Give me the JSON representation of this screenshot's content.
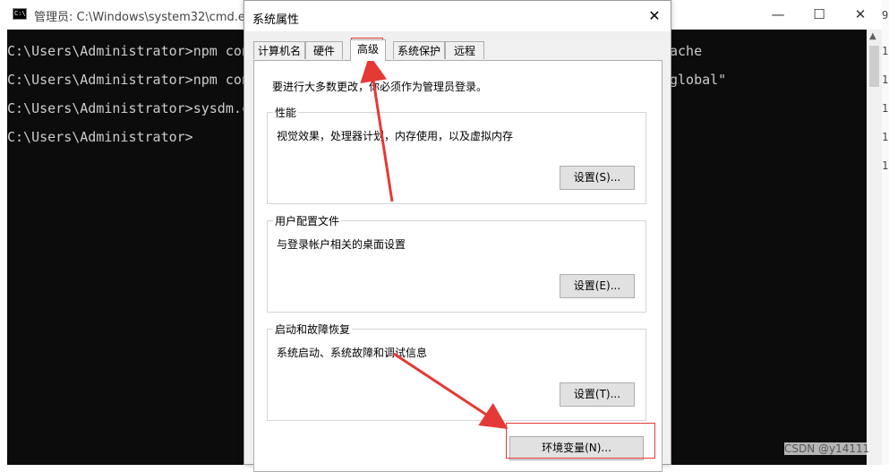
{
  "cmd": {
    "title": "管理员: C:\\Windows\\system32\\cmd.exe",
    "icon_label": "C:\\",
    "lines": [
      "C:\\Users\\Administrator>npm config",
      "C:\\Users\\Administrator>npm config",
      "C:\\Users\\Administrator>sysdm.cpl",
      "C:\\Users\\Administrator>"
    ],
    "right_fragments": [
      "ache",
      "global\""
    ],
    "minimize": "—",
    "maximize": "☐",
    "close": "✕",
    "side_numbers": [
      "9",
      "1",
      "1",
      "1",
      "1",
      "1"
    ]
  },
  "dialog": {
    "title": "系统属性",
    "close": "✕",
    "tabs": [
      {
        "label": "计算机名"
      },
      {
        "label": "硬件"
      },
      {
        "label": "高级"
      },
      {
        "label": "系统保护"
      },
      {
        "label": "远程"
      }
    ],
    "active_tab": "高级",
    "notice": "要进行大多数更改，你必须作为管理员登录。",
    "groups": [
      {
        "label": "性能",
        "desc": "视觉效果，处理器计划，内存使用，以及虚拟内存",
        "button": "设置(S)..."
      },
      {
        "label": "用户配置文件",
        "desc": "与登录帐户相关的桌面设置",
        "button": "设置(E)..."
      },
      {
        "label": "启动和故障恢复",
        "desc": "系统启动、系统故障和调试信息",
        "button": "设置(T)..."
      }
    ],
    "env_button": "环境变量(N)..."
  },
  "annotation": {
    "color": "#e53935"
  },
  "watermark": "CSDN @y14111"
}
